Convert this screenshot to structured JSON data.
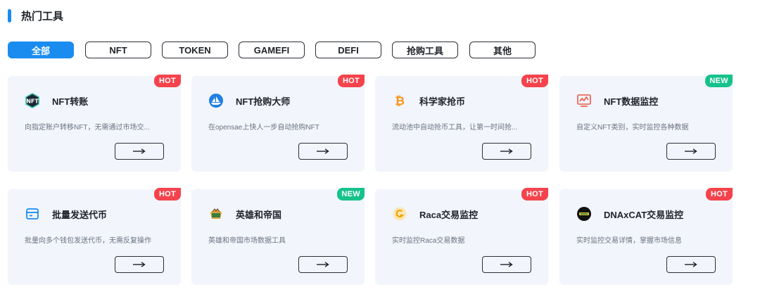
{
  "section": {
    "title": "热门工具"
  },
  "filters": [
    "全部",
    "NFT",
    "TOKEN",
    "GAMEFI",
    "DEFI",
    "抢购工具",
    "其他"
  ],
  "active_filter": "全部",
  "colors": {
    "accent": "#1a8cf0",
    "hot": "#f4434c",
    "new": "#16c28a",
    "card_bg": "#f2f5fb"
  },
  "cards": [
    {
      "badge": "HOT",
      "icon": "nft-logo-icon",
      "title": "NFT转账",
      "desc": "向指定账户转移NFT，无需通过市场交...",
      "action": "→"
    },
    {
      "badge": "HOT",
      "icon": "opensea-icon",
      "title": "NFT抢购大师",
      "desc": "在opensae上快人一步自动抢购NFT",
      "action": "→"
    },
    {
      "badge": "HOT",
      "icon": "bitcoin-icon",
      "title": "科学家抢币",
      "desc": "流动池中自动抢币工具，让第一时间抢...",
      "action": "→"
    },
    {
      "badge": "NEW",
      "icon": "monitor-chart-icon",
      "title": "NFT数据监控",
      "desc": "自定义NFT类别，实时监控各种数据",
      "action": "→"
    },
    {
      "badge": "HOT",
      "icon": "wallet-card-icon",
      "title": "批量发送代币",
      "desc": "批量向多个钱包发送代币，无需反复操作",
      "action": "→"
    },
    {
      "badge": "NEW",
      "icon": "heroes-empires-icon",
      "title": "英雄和帝国",
      "desc": "英雄和帝国市场数据工具",
      "action": "→"
    },
    {
      "badge": "HOT",
      "icon": "raca-coin-icon",
      "title": "Raca交易监控",
      "desc": "实时监控Raca交易数据",
      "action": "→"
    },
    {
      "badge": "HOT",
      "icon": "dnaxcat-icon",
      "title": "DNAxCAT交易监控",
      "desc": "实时监控交易详情，掌握市场信息",
      "action": "→"
    }
  ]
}
